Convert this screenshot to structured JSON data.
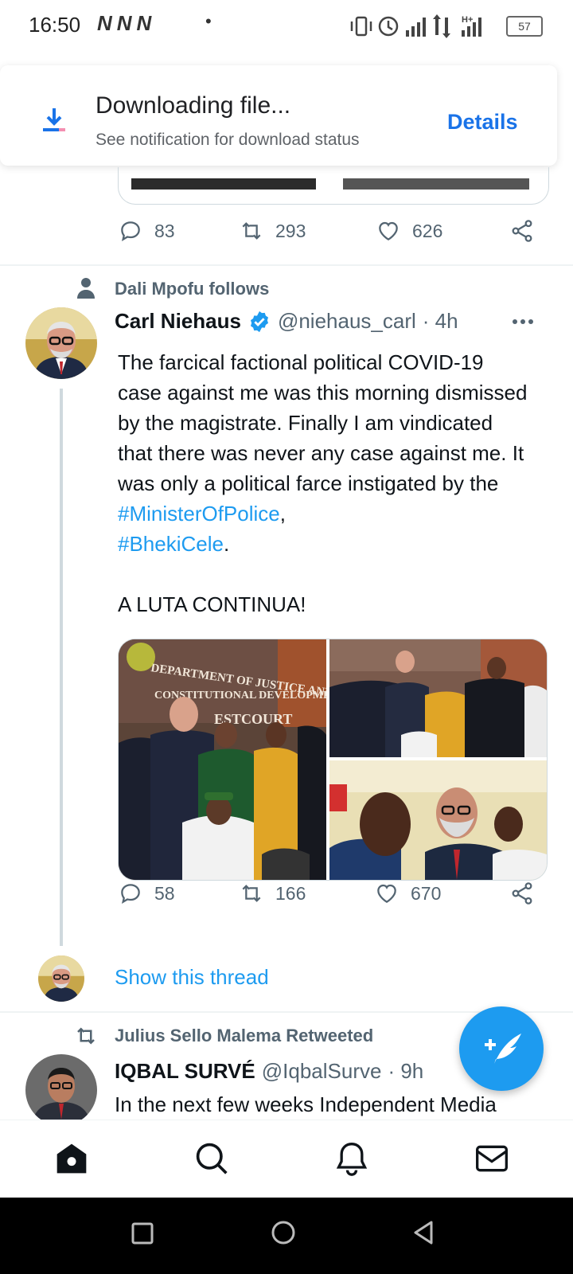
{
  "status_bar": {
    "time": "16:50",
    "notif_icons": "NNN",
    "dot": "•",
    "battery": "57"
  },
  "toast": {
    "title": "Downloading file...",
    "subtitle": "See notification for download status",
    "details_label": "Details",
    "icon": "download-icon"
  },
  "prev_tweet": {
    "replies": "83",
    "retweets": "293",
    "likes": "626"
  },
  "tweet": {
    "social_context": "Dali Mpofu follows",
    "name": "Carl Niehaus",
    "handle": "@niehaus_carl",
    "time": "· 4h",
    "body_1": "The farcical factional political COVID-19 case against me was this morning dismissed by the magistrate. Finally I am vindicated that there was never any case against me. It was only a political farce instigated by the ",
    "hashtag_1": "#MinisterOfPolice",
    "comma": ",",
    "hashtag_2": "#BhekiCele",
    "period": ".",
    "body_2": "A LUTA CONTINUA!",
    "photo_sign_1": "DEPARTMENT OF JUSTICE AND",
    "photo_sign_2": "CONSTITUTIONAL DEVELOPMENT",
    "photo_sign_3": "ESTCOURT",
    "replies": "58",
    "retweets": "166",
    "likes": "670",
    "show_thread": "Show this thread"
  },
  "next_tweet": {
    "social_context": "Julius Sello Malema Retweeted",
    "name": "IQBAL SURVÉ",
    "handle": "@IqbalSurve",
    "time": "· 9h",
    "body": "In the next few weeks Independent Media"
  },
  "bottom_nav": [
    "home-icon",
    "search-icon",
    "bell-icon",
    "mail-icon"
  ],
  "colors": {
    "accent": "#1d9bf0",
    "text": "#0f1419",
    "muted": "#536471"
  }
}
